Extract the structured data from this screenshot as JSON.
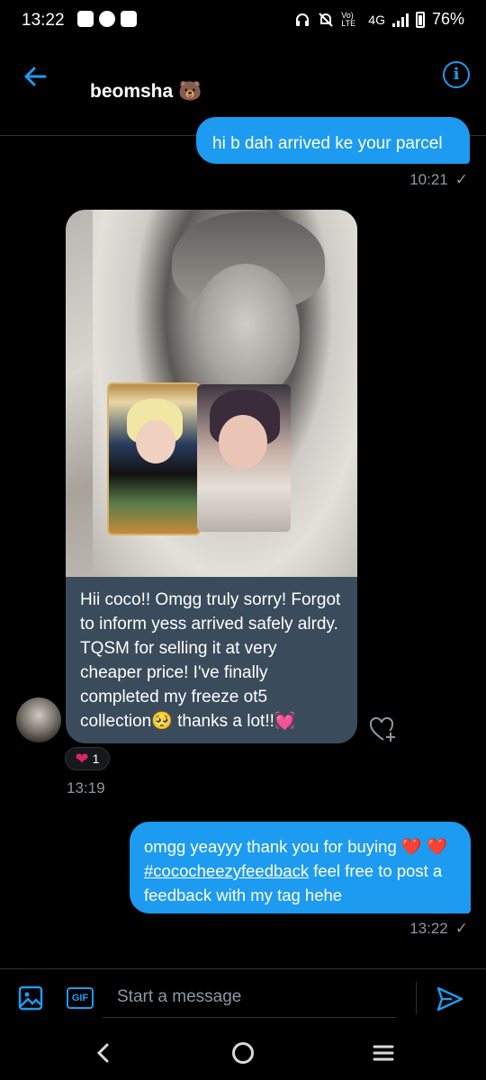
{
  "status_bar": {
    "time": "13:22",
    "battery": "76%",
    "network": "4G",
    "volte": "Vo) LTE",
    "icons": [
      "mail-icon",
      "app-icon",
      "mail-icon",
      "headphones-icon",
      "mute-icon",
      "signal-icon",
      "battery-icon"
    ]
  },
  "header": {
    "title": "beomsha 🐻",
    "back_icon": "arrow-left-icon",
    "info_icon": "info-icon",
    "info_glyph": "i"
  },
  "messages": [
    {
      "direction": "outgoing",
      "text": "hi b dah arrived ke your parcel",
      "time": "10:21",
      "status": "✓"
    },
    {
      "direction": "incoming",
      "has_photo": true,
      "text": "Hii coco!! Omgg truly sorry! Forgot to inform yess arrived safely alrdy. TQSM for selling it at very cheaper price! I've finally completed my freeze ot5 collection🥺 thanks a lot!!💓",
      "time": "13:19",
      "reaction": {
        "emoji": "❤️",
        "count": "1"
      }
    },
    {
      "direction": "outgoing",
      "text_before": "omgg yeayyy thank you for buying ❤️ ❤️ ",
      "hashtag": "#cococheezyfeedback",
      "text_after": " feel free to post a feedback with my tag hehe",
      "time": "13:22",
      "status": "✓"
    }
  ],
  "composer": {
    "placeholder": "Start a message",
    "gif_label": "GIF",
    "image_icon": "image-icon",
    "send_icon": "send-icon"
  },
  "navbar": {
    "icons": [
      "back-chevron-icon",
      "home-circle-icon",
      "recent-apps-icon"
    ]
  },
  "colors": {
    "accent": "#1d9bf0",
    "incoming_bubble": "#3a4b5c",
    "meta_text": "#8b98a5",
    "background": "#000000"
  }
}
